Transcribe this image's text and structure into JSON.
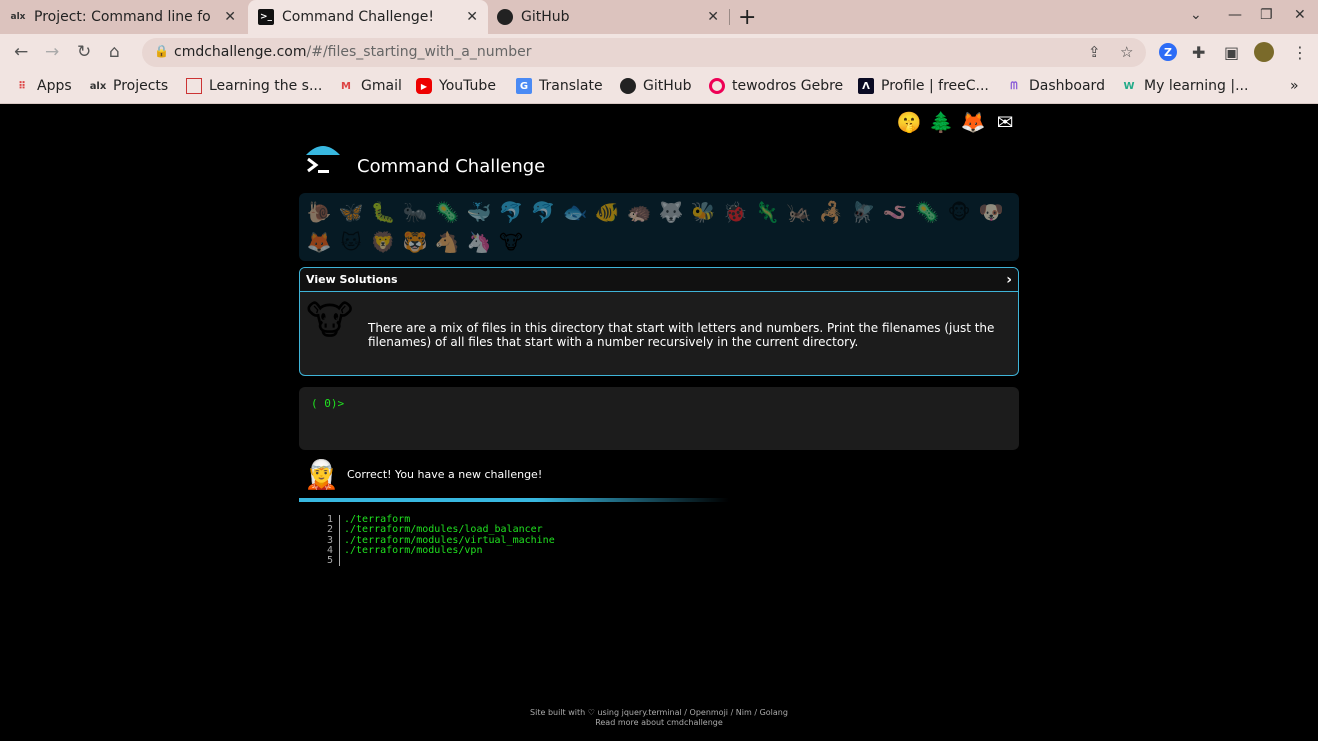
{
  "browser": {
    "tabs": [
      {
        "icon": "alx-icon",
        "favicon_text": "alx",
        "title": "Project: Command line fo",
        "active": false
      },
      {
        "icon": "terminal-icon",
        "favicon_text": ">_",
        "title": "Command Challenge!",
        "active": true
      },
      {
        "icon": "github-icon",
        "favicon_text": "",
        "title": "GitHub",
        "active": false
      }
    ],
    "url_host": "cmdchallenge.com",
    "url_path": "/#/files_starting_with_a_number",
    "profile_initial": "Z",
    "bookmarks": [
      {
        "icon": "apps-grid-icon",
        "label": "Apps"
      },
      {
        "icon": "alx-icon",
        "label": "Projects"
      },
      {
        "icon": "doc-icon",
        "label": "Learning the s..."
      },
      {
        "icon": "gmail-icon",
        "label": "Gmail"
      },
      {
        "icon": "youtube-icon",
        "label": "YouTube"
      },
      {
        "icon": "translate-icon",
        "label": "Translate"
      },
      {
        "icon": "github-icon",
        "label": "GitHub"
      },
      {
        "icon": "spiral-icon",
        "label": "tewodros Gebre"
      },
      {
        "icon": "freecodecamp-icon",
        "label": "Profile | freeC..."
      },
      {
        "icon": "dashboard-icon",
        "label": "Dashboard"
      },
      {
        "icon": "w-icon",
        "label": "My learning |..."
      }
    ]
  },
  "page": {
    "brand": "Command Challenge",
    "top_icons": [
      "🖥",
      "🤫",
      "🌲",
      "🦊",
      "✉"
    ],
    "challenge_animals": [
      "🐌",
      "🦋",
      "🐛",
      "🐜",
      "🦠",
      "🐳",
      "🐬",
      "🐬",
      "🐟",
      "🐠",
      "🦔",
      "🐺",
      "🐝",
      "🐞",
      "🦎",
      "🦗",
      "🦂",
      "🪰",
      "🪱",
      "🦠",
      "🐵",
      "🐶",
      "🦊",
      "🐱",
      "🦁",
      "🐯",
      "🐴",
      "🦄",
      "🐮"
    ],
    "current_animal": "🐮",
    "panel": {
      "heading": "View Solutions",
      "chevron": "›",
      "avatar": "🐮",
      "description": "There are a mix of files in this directory that start with letters and numbers. Print the filenames (just the filenames) of all files that start with a number recursively in the current directory."
    },
    "terminal": {
      "prompt": "( 0)>"
    },
    "feedback": {
      "avatar": "🧝",
      "message": "Correct! You have a new challenge!"
    },
    "output": {
      "line_numbers": [
        "1",
        "2",
        "3",
        "4",
        "5"
      ],
      "lines": [
        "./terraform",
        "./terraform/modules/load_balancer",
        "./terraform/modules/virtual_machine",
        "./terraform/modules/vpn",
        ""
      ]
    },
    "footer": {
      "line1": "Site built with ♡ using jquery.terminal / Openmoji / Nim / Golang",
      "line2": "Read more about cmdchallenge"
    }
  },
  "colors": {
    "accent": "#3fb4d8",
    "terminal_green": "#20e020"
  }
}
